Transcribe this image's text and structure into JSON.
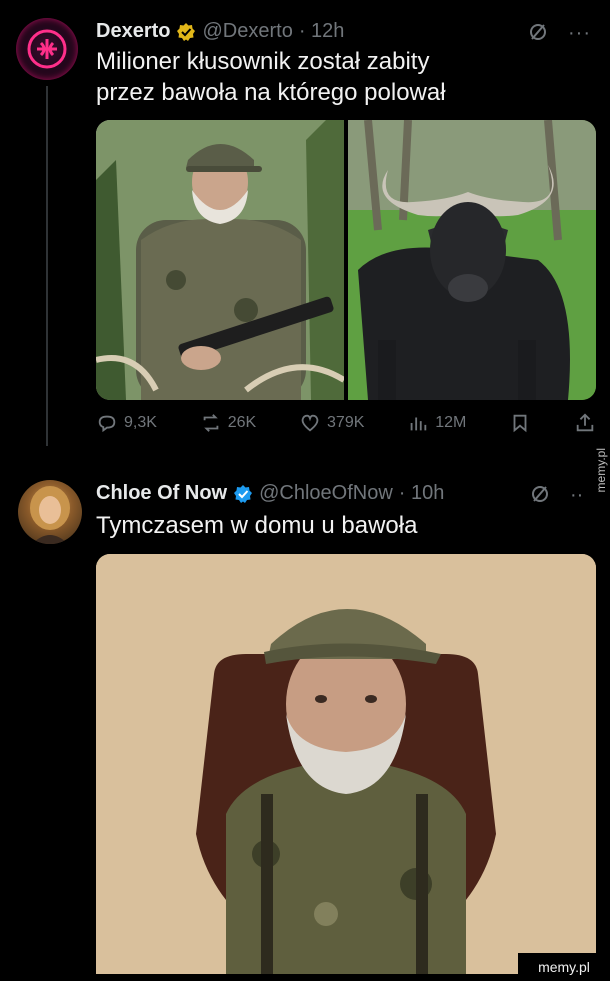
{
  "tweet1": {
    "name": "Dexerto",
    "handle": "@Dexerto",
    "time": "· 12h",
    "text_line1": "Milioner kłusownik został zabity",
    "text_line2": "przez bawoła na którego polował",
    "actions": {
      "replies": "9,3K",
      "reposts": "26K",
      "likes": "379K",
      "views": "12M"
    }
  },
  "tweet2": {
    "name": "Chloe Of Now",
    "handle": "@ChloeOfNow",
    "time": "· 10h",
    "text": "Tymczasem w domu u bawoła"
  },
  "watermark": "memy.pl",
  "colors": {
    "background": "#000000",
    "muted": "#71767b",
    "verified_gold": "#e2b719",
    "verified_blue": "#1d9bf0"
  }
}
